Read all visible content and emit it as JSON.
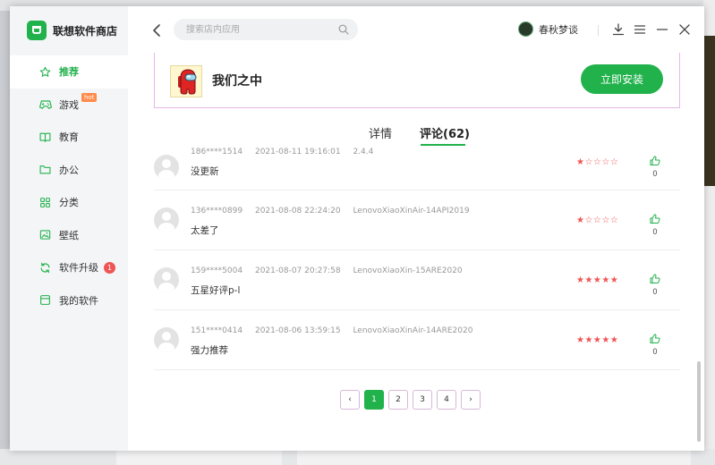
{
  "sidebar": {
    "logo_text": "联想软件商店",
    "items": [
      {
        "label": "推荐",
        "icon": "star-icon",
        "active": true
      },
      {
        "label": "游戏",
        "icon": "gamepad-icon",
        "tag": "hot"
      },
      {
        "label": "教育",
        "icon": "book-icon"
      },
      {
        "label": "办公",
        "icon": "folder-icon"
      },
      {
        "label": "分类",
        "icon": "grid-icon"
      },
      {
        "label": "壁纸",
        "icon": "image-icon"
      },
      {
        "label": "软件升级",
        "icon": "refresh-icon",
        "badge": "1"
      },
      {
        "label": "我的软件",
        "icon": "box-icon"
      }
    ]
  },
  "header": {
    "search_placeholder": "搜索店内应用",
    "user_name": "春秋梦谈"
  },
  "app": {
    "name": "我们之中",
    "install_label": "立即安装"
  },
  "tabs": [
    {
      "label": "详情"
    },
    {
      "label": "评论(62)",
      "active": true
    }
  ],
  "reviews": [
    {
      "user": "186****1514",
      "date": "2021-08-11 19:16:01",
      "device": "2.4.4",
      "text": "没更新",
      "rating": 1,
      "likes": "0"
    },
    {
      "user": "136****0899",
      "date": "2021-08-08 22:24:20",
      "device": "LenovoXiaoXinAir-14API2019",
      "text": "太差了",
      "rating": 1,
      "likes": "0"
    },
    {
      "user": "159****5004",
      "date": "2021-08-07 20:27:58",
      "device": "LenovoXiaoXin-15ARE2020",
      "text": "五星好评p-l",
      "rating": 5,
      "likes": "0"
    },
    {
      "user": "151****0414",
      "date": "2021-08-06 13:59:15",
      "device": "LenovoXiaoXinAir-14ARE2020",
      "text": "强力推荐",
      "rating": 5,
      "likes": "0"
    }
  ],
  "pagination": {
    "prev": "‹",
    "pages": [
      "1",
      "2",
      "3",
      "4"
    ],
    "current": "1",
    "next": "›"
  },
  "colors": {
    "accent": "#21b24c",
    "star": "#f05454",
    "badge": "#f05454",
    "hot": "#ff8a4a"
  }
}
